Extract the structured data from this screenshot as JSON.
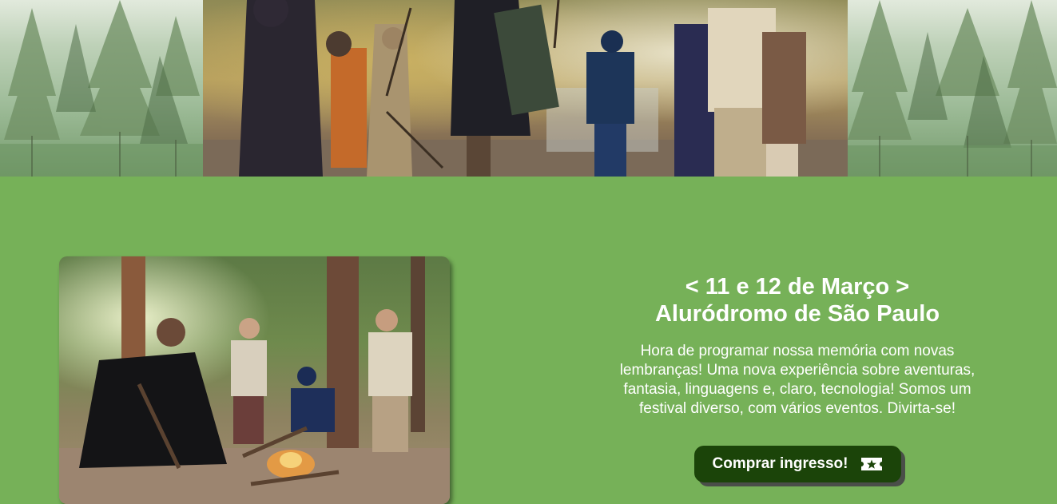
{
  "event": {
    "date": "< 11 e 12 de Março >",
    "venue": "Aluródromo de São Paulo",
    "description": "Hora de programar nossa memória com novas lembranças! Uma nova experiência sobre aventuras, fantasia, linguagens e, claro, tecnologia! Somos um festival diverso, com vários eventos. Divirta-se!"
  },
  "cta": {
    "label": "Comprar ingresso!",
    "icon": "ticket-icon"
  },
  "colors": {
    "background": "#76b158",
    "button": "#1b4409",
    "button_shadow": "#4a4e49",
    "text": "#ffffff"
  }
}
